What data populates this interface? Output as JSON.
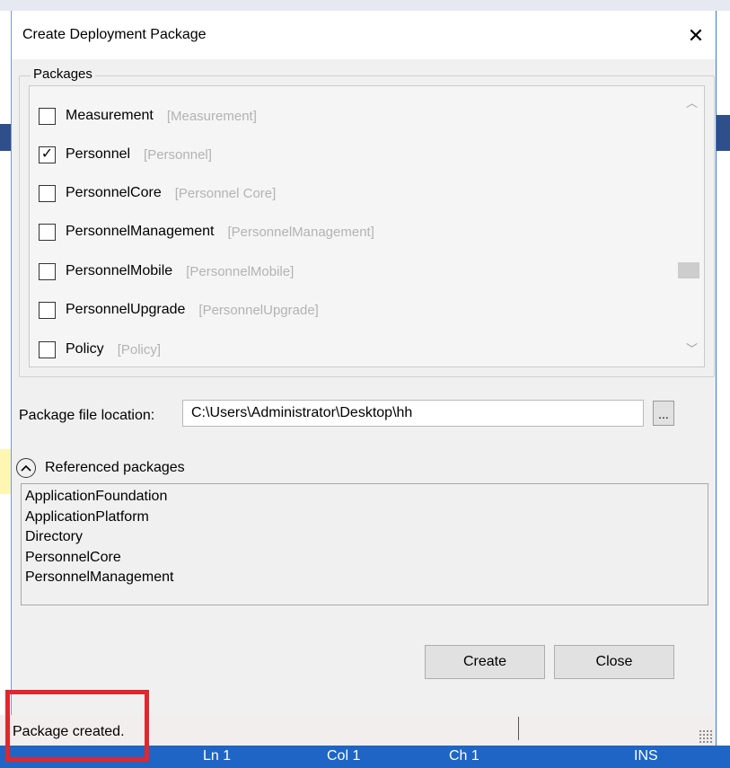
{
  "dialog": {
    "title": "Create Deployment Package",
    "close_glyph": "✕",
    "packages_group_label": "Packages",
    "packages": [
      {
        "name": "Measurement",
        "tag": "[Measurement]",
        "checked": false
      },
      {
        "name": "Personnel",
        "tag": "[Personnel]",
        "checked": true
      },
      {
        "name": "PersonnelCore",
        "tag": "[Personnel Core]",
        "checked": false
      },
      {
        "name": "PersonnelManagement",
        "tag": "[PersonnelManagement]",
        "checked": false
      },
      {
        "name": "PersonnelMobile",
        "tag": "[PersonnelMobile]",
        "checked": false
      },
      {
        "name": "PersonnelUpgrade",
        "tag": "[PersonnelUpgrade]",
        "checked": false
      },
      {
        "name": "Policy",
        "tag": "[Policy]",
        "checked": false
      }
    ],
    "file_location_label": "Package file location:",
    "file_location_value": "C:\\Users\\Administrator\\Desktop\\hh",
    "browse_label": "...",
    "referenced_label": "Referenced packages",
    "referenced_packages": [
      "ApplicationFoundation",
      "ApplicationPlatform",
      "Directory",
      "PersonnelCore",
      "PersonnelManagement"
    ],
    "create_label": "Create",
    "close_label": "Close"
  },
  "status": {
    "message": "Package created.",
    "ln": "Ln 1",
    "col": "Col 1",
    "ch": "Ch 1",
    "mode": "INS"
  },
  "colors": {
    "status_bar": "#1f65c5",
    "highlight": "#e0262e"
  }
}
